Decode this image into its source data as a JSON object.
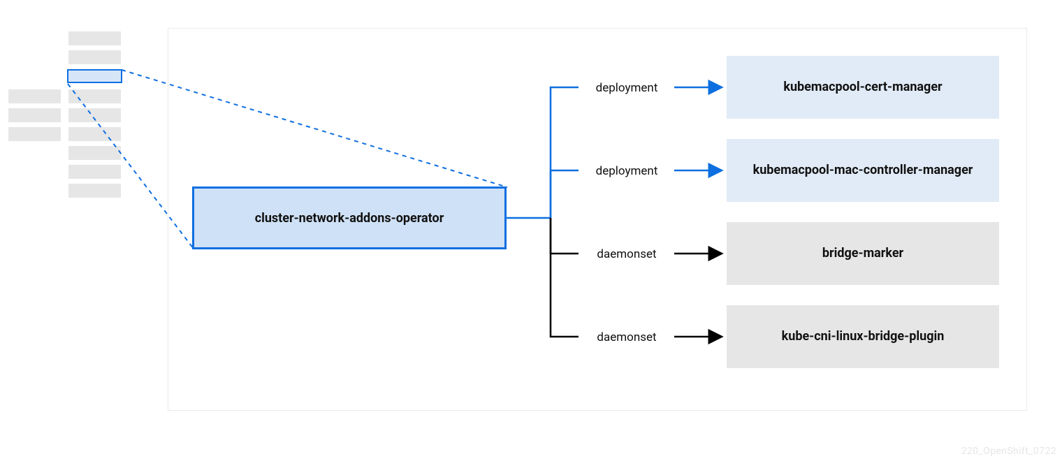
{
  "operator": {
    "label": "cluster-network-addons-operator"
  },
  "children": [
    {
      "kind": "deployment",
      "label": "kubemacpool-cert-manager",
      "variant": "blue"
    },
    {
      "kind": "deployment",
      "label": "kubemacpool-mac-controller-manager",
      "variant": "blue"
    },
    {
      "kind": "daemonset",
      "label": "bridge-marker",
      "variant": "grey"
    },
    {
      "kind": "daemonset",
      "label": "kube-cni-linux-bridge-plugin",
      "variant": "grey"
    }
  ],
  "colors": {
    "blue": "#0e6fe0",
    "black": "#000000"
  },
  "watermark": "220_OpenShift_0722"
}
